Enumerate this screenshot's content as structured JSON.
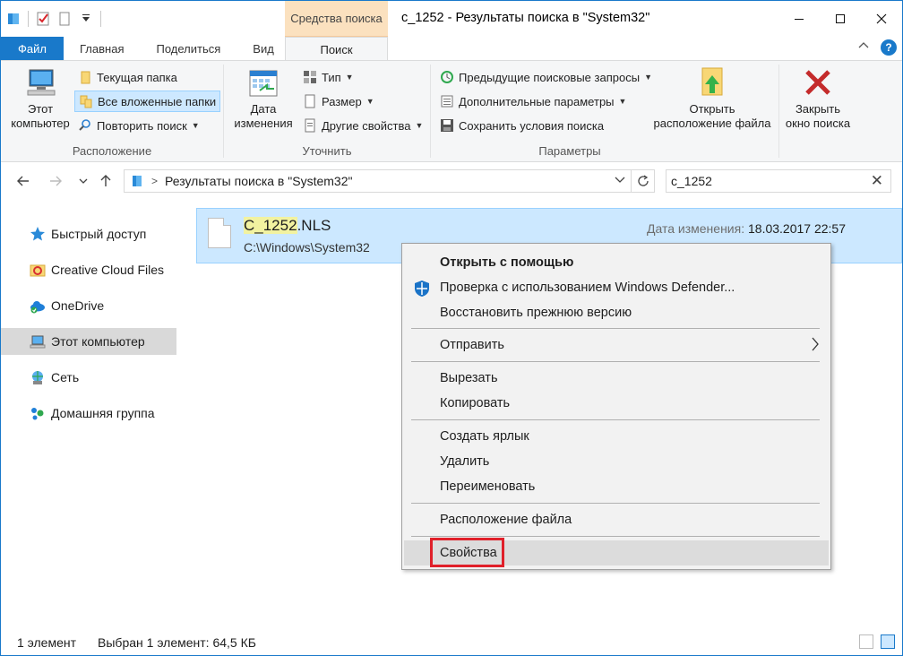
{
  "window": {
    "title": "c_1252 - Результаты поиска в \"System32\"",
    "contextual_tab_group": "Средства поиска"
  },
  "ribbon_tabs": [
    {
      "label": "Файл"
    },
    {
      "label": "Главная"
    },
    {
      "label": "Поделиться"
    },
    {
      "label": "Вид"
    },
    {
      "label": "Поиск"
    }
  ],
  "ribbon": {
    "location": {
      "label": "Расположение",
      "this_pc_label": "Этот компьютер",
      "current_folder": "Текущая папка",
      "all_subfolders": "Все вложенные папки",
      "search_again": "Повторить поиск"
    },
    "refine": {
      "label": "Уточнить",
      "date_modified": "Дата изменения",
      "kind": "Тип",
      "size": "Размер",
      "other_properties": "Другие свойства"
    },
    "options": {
      "label": "Параметры",
      "recent_searches": "Предыдущие поисковые запросы",
      "advanced_options": "Дополнительные параметры",
      "save_search": "Сохранить условия поиска",
      "open_file_location": "Открыть расположение файла",
      "close_search": "Закрыть окно поиска"
    }
  },
  "address": {
    "breadcrumb": "Результаты поиска в \"System32\"",
    "search_value": "c_1252"
  },
  "sidebar": {
    "items": [
      {
        "label": "Быстрый доступ"
      },
      {
        "label": "Creative Cloud Files"
      },
      {
        "label": "OneDrive"
      },
      {
        "label": "Этот компьютер"
      },
      {
        "label": "Сеть"
      },
      {
        "label": "Домашняя группа"
      }
    ]
  },
  "file": {
    "name_match": "C_1252",
    "name_rest": ".NLS",
    "path": "C:\\Windows\\System32",
    "date_label": "Дата изменения:",
    "date_value": "18.03.2017 22:57"
  },
  "context_menu": {
    "items": [
      {
        "label": "Открыть с помощью"
      },
      {
        "label": "Проверка с использованием Windows Defender..."
      },
      {
        "label": "Восстановить прежнюю версию"
      },
      {
        "label": "Отправить"
      },
      {
        "label": "Вырезать"
      },
      {
        "label": "Копировать"
      },
      {
        "label": "Создать ярлык"
      },
      {
        "label": "Удалить"
      },
      {
        "label": "Переименовать"
      },
      {
        "label": "Расположение файла"
      },
      {
        "label": "Свойства"
      }
    ]
  },
  "status": {
    "count": "1 элемент",
    "selection": "Выбран 1 элемент: 64,5 КБ"
  },
  "colors": {
    "accent": "#1979ca",
    "selection": "#cce8ff",
    "highlight_box": "#e0202a",
    "search_tools_tab": "#fbe1bf"
  }
}
